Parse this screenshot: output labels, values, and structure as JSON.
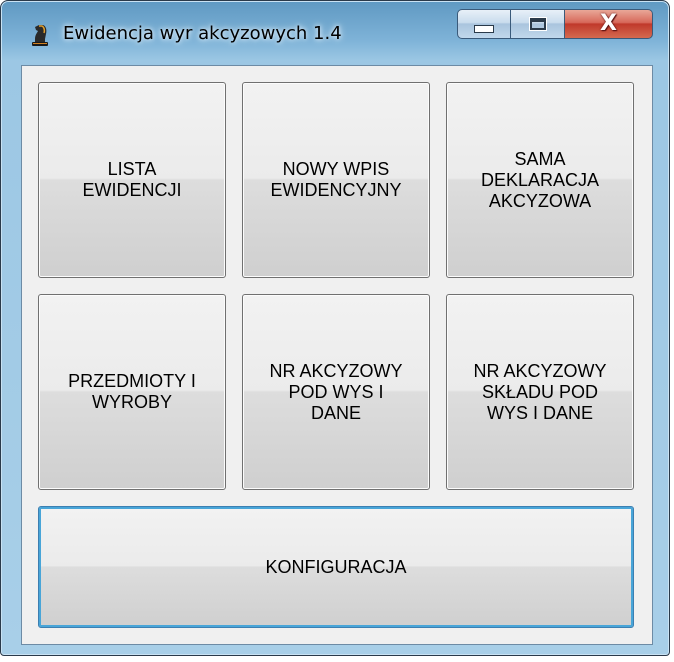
{
  "window": {
    "title": "Ewidencja wyr akcyzowych 1.4",
    "app_icon": "chess-knight-icon",
    "caption_buttons": {
      "minimize_icon": "minimize-icon",
      "maximize_icon": "maximize-icon",
      "close_label": "X"
    }
  },
  "buttons": {
    "lista_ewidencji": "LISTA\nEWIDENCJI",
    "nowy_wpis": "NOWY WPIS\nEWIDENCYJNY",
    "sama_deklaracja": "SAMA\nDEKLARACJA\nAKCYZOWA",
    "przedmioty": "PRZEDMIOTY I\nWYROBY",
    "nr_akcyzowy_pod": "NR AKCYZOWY\nPOD WYS I\nDANE",
    "nr_akcyzowy_skladu": "NR AKCYZOWY\nSKŁADU POD\nWYS I DANE",
    "konfiguracja": "KONFIGURACJA"
  },
  "colors": {
    "titlebar": "#7fb3d8",
    "close_button": "#c0392b",
    "client_bg": "#f0f0f0",
    "focus_border": "#48a5d8"
  }
}
